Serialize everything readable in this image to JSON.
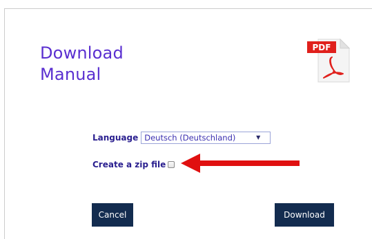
{
  "dialog": {
    "title_line1": "Download",
    "title_line2": "Manual",
    "pdf_badge": "PDF"
  },
  "form": {
    "language_label": "Language",
    "language_selected": "Deutsch (Deutschland)",
    "zip_label": "Create a zip file",
    "zip_checked": false
  },
  "buttons": {
    "cancel_label": "Cancel",
    "download_label": "Download"
  },
  "icons": {
    "pdf": "pdf-file-icon",
    "dropdown": "chevron-down-icon",
    "annotation": "red-arrow-annotation"
  },
  "colors": {
    "title": "#5a2fd0",
    "label": "#2a1f8f",
    "button_bg": "#132c4f",
    "arrow": "#e01010",
    "pdf_red": "#e0201c"
  }
}
